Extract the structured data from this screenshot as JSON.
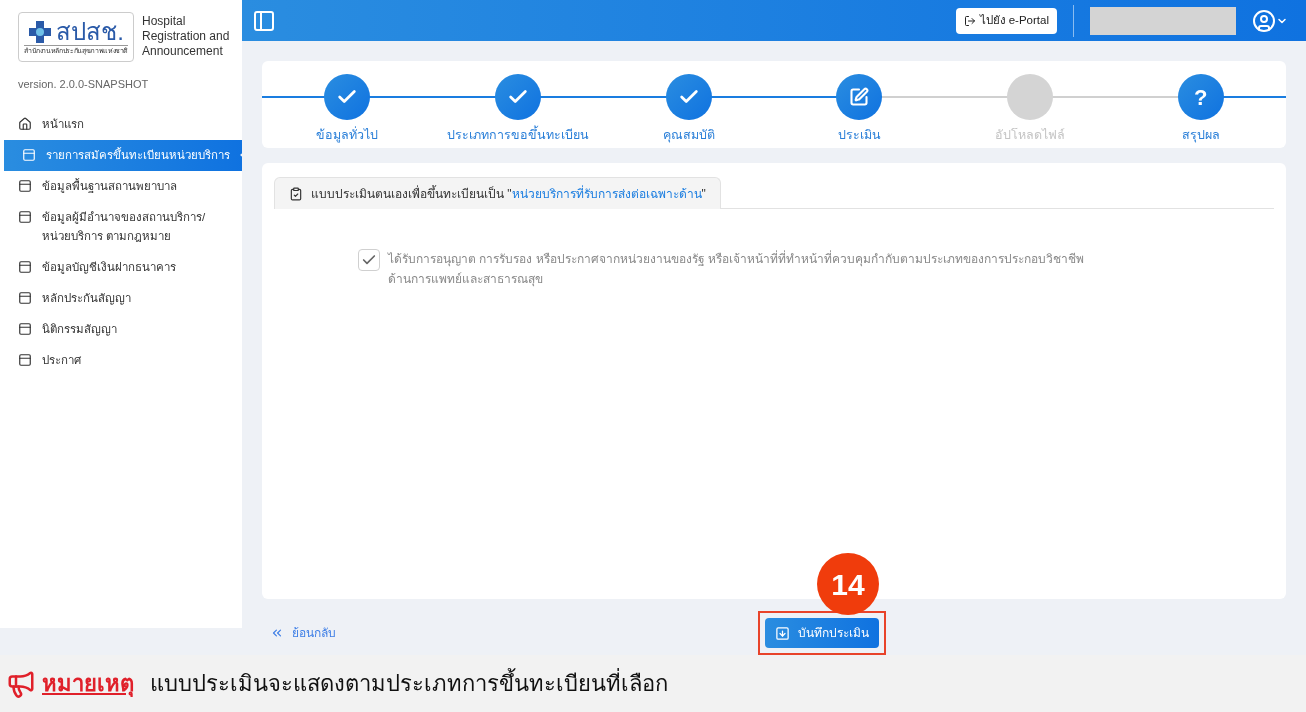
{
  "logo": {
    "mark": "สปสช.",
    "subtitle": "สำนักงานหลักประกันสุขภาพแห่งชาติ",
    "title_lines": [
      "Hospital",
      "Registration and",
      "Announcement"
    ]
  },
  "version": "version. 2.0.0-SNAPSHOT",
  "sidebar": {
    "items": [
      {
        "label": "หน้าแรก",
        "kind": "home",
        "selected": false
      },
      {
        "label": "รายการสมัครขึ้นทะเบียนหน่วยบริการ",
        "kind": "page",
        "selected": true
      },
      {
        "label": "ข้อมูลพื้นฐานสถานพยาบาล",
        "kind": "page",
        "selected": false
      },
      {
        "label": "ข้อมูลผู้มีอำนาจของสถานบริการ/หน่วยบริการ ตามกฎหมาย",
        "kind": "page",
        "selected": false
      },
      {
        "label": "ข้อมูลบัญชีเงินฝากธนาคาร",
        "kind": "page",
        "selected": false
      },
      {
        "label": "หลักประกันสัญญา",
        "kind": "page",
        "selected": false
      },
      {
        "label": "นิติกรรมสัญญา",
        "kind": "page",
        "selected": false
      },
      {
        "label": "ประกาศ",
        "kind": "page",
        "selected": false
      }
    ]
  },
  "header": {
    "portal_button": "ไปยัง e-Portal"
  },
  "steps": [
    {
      "label": "ข้อมูลทั่วไป",
      "kind": "done"
    },
    {
      "label": "ประเภทการขอขึ้นทะเบียน",
      "kind": "done"
    },
    {
      "label": "คุณสมบัติ",
      "kind": "done"
    },
    {
      "label": "ประเมิน",
      "kind": "current"
    },
    {
      "label": "อัปโหลดไฟล์",
      "kind": "pending"
    },
    {
      "label": "สรุปผล",
      "kind": "final",
      "symbol": "?"
    }
  ],
  "form": {
    "tab": {
      "prefix": "แบบประเมินตนเองเพื่อขึ้นทะเบียนเป็น \"",
      "highlight": "หน่วยบริการที่รับการส่งต่อเฉพาะด้าน",
      "suffix": "\""
    },
    "items": [
      {
        "label": "ได้รับการอนุญาต การรับรอง หรือประกาศจากหน่วยงานของรัฐ หรือเจ้าหน้าที่ที่ทำหน้าที่ควบคุมกำกับตามประเภทของการประกอบวิชาชีพด้านการแพทย์และสาธารณสุข",
        "checked": true
      }
    ]
  },
  "footer": {
    "back": "ย้อนกลับ",
    "save": "บันทึกประเมิน",
    "callout_number": "14"
  },
  "note": {
    "label": "หมายเหตุ",
    "text": "แบบประเมินจะแสดงตามประเภทการขึ้นทะเบียนที่เลือก"
  }
}
